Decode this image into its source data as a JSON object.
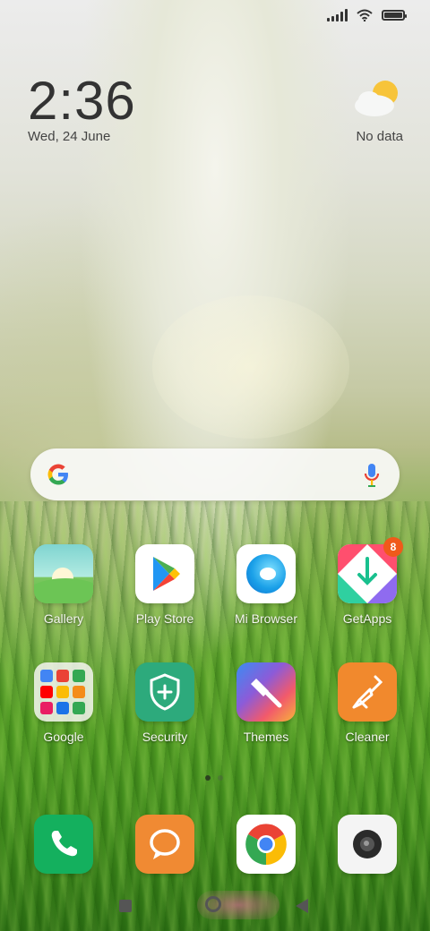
{
  "status_bar": {
    "icons": [
      "signal-icon",
      "wifi-icon",
      "battery-icon"
    ],
    "battery_level": 1.0
  },
  "clock": {
    "time": "2:36",
    "date": "Wed, 24 June"
  },
  "weather": {
    "icon": "partly-cloudy-icon",
    "text": "No data"
  },
  "search_bar": {
    "left_icon": "google-icon",
    "right_icon": "microphone-icon"
  },
  "apps": [
    {
      "label": "Gallery",
      "icon": "gallery-icon"
    },
    {
      "label": "Play Store",
      "icon": "play-store-icon"
    },
    {
      "label": "Mi Browser",
      "icon": "mi-browser-icon"
    },
    {
      "label": "GetApps",
      "icon": "getapps-icon",
      "badge": "8"
    },
    {
      "label": "Google",
      "icon": "google-folder-icon"
    },
    {
      "label": "Security",
      "icon": "security-icon"
    },
    {
      "label": "Themes",
      "icon": "themes-icon"
    },
    {
      "label": "Cleaner",
      "icon": "cleaner-icon"
    }
  ],
  "page_indicator": {
    "pages": 2,
    "current": 1
  },
  "dock": [
    {
      "icon": "phone-icon"
    },
    {
      "icon": "messaging-icon"
    },
    {
      "icon": "chrome-icon"
    },
    {
      "icon": "camera-icon"
    }
  ],
  "nav_bar": {
    "buttons": [
      "recents-button",
      "home-button",
      "back-button"
    ]
  },
  "colors": {
    "badge": "#f05a1a",
    "text_dark": "#333333",
    "label_light": "#f4f7ef"
  }
}
